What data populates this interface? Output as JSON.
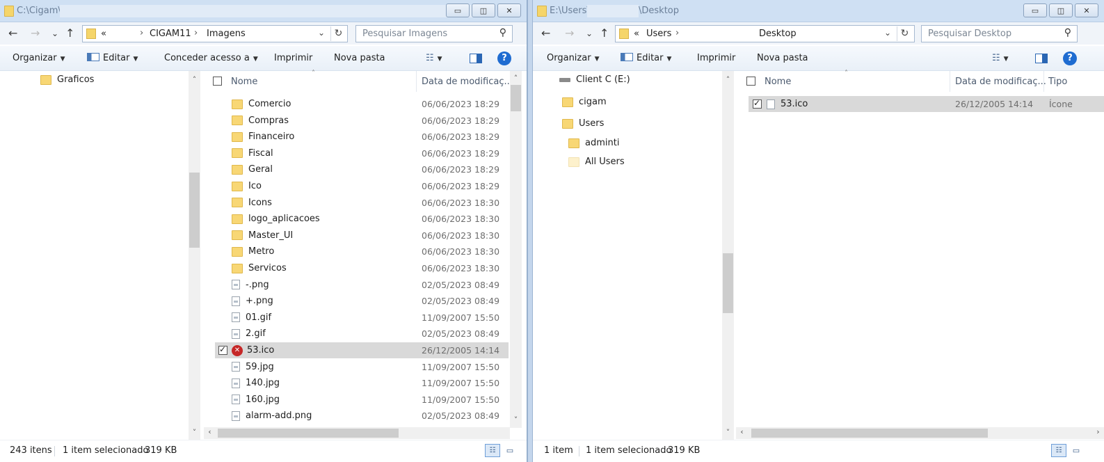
{
  "left": {
    "title": "C:\\Cigam\\",
    "breadcrumb": {
      "root": "«",
      "parts": [
        "CIGAM11",
        "Imagens"
      ]
    },
    "search_placeholder": "Pesquisar Imagens",
    "toolbar": {
      "organize": "Organizar",
      "edit": "Editar",
      "share": "Conceder acesso a",
      "print": "Imprimir",
      "new_folder": "Nova pasta"
    },
    "nav": [
      {
        "label": "Graficos",
        "icon": "folder-icon"
      }
    ],
    "columns": {
      "name": "Nome",
      "date": "Data de modificaç..."
    },
    "files": [
      {
        "name": "Comercio",
        "date": "06/06/2023 18:29",
        "icon": "folder-icon"
      },
      {
        "name": "Compras",
        "date": "06/06/2023 18:29",
        "icon": "folder-icon"
      },
      {
        "name": "Financeiro",
        "date": "06/06/2023 18:29",
        "icon": "folder-icon"
      },
      {
        "name": "Fiscal",
        "date": "06/06/2023 18:29",
        "icon": "folder-icon"
      },
      {
        "name": "Geral",
        "date": "06/06/2023 18:29",
        "icon": "folder-icon"
      },
      {
        "name": "Ico",
        "date": "06/06/2023 18:29",
        "icon": "folder-icon"
      },
      {
        "name": "Icons",
        "date": "06/06/2023 18:30",
        "icon": "folder-icon"
      },
      {
        "name": "logo_aplicacoes",
        "date": "06/06/2023 18:30",
        "icon": "folder-icon"
      },
      {
        "name": "Master_UI",
        "date": "06/06/2023 18:30",
        "icon": "folder-icon"
      },
      {
        "name": "Metro",
        "date": "06/06/2023 18:30",
        "icon": "folder-icon"
      },
      {
        "name": "Servicos",
        "date": "06/06/2023 18:30",
        "icon": "folder-icon"
      },
      {
        "name": "-.png",
        "date": "02/05/2023 08:49",
        "icon": "image-file-icon"
      },
      {
        "name": "+.png",
        "date": "02/05/2023 08:49",
        "icon": "image-file-icon"
      },
      {
        "name": "01.gif",
        "date": "11/09/2007 15:50",
        "icon": "image-file-icon"
      },
      {
        "name": "2.gif",
        "date": "02/05/2023 08:49",
        "icon": "image-file-icon"
      },
      {
        "name": "53.ico",
        "date": "26/12/2005 14:14",
        "icon": "error-icon",
        "selected": true
      },
      {
        "name": "59.jpg",
        "date": "11/09/2007 15:50",
        "icon": "image-file-icon"
      },
      {
        "name": "140.jpg",
        "date": "11/09/2007 15:50",
        "icon": "image-file-icon"
      },
      {
        "name": "160.jpg",
        "date": "11/09/2007 15:50",
        "icon": "image-file-icon"
      },
      {
        "name": "alarm-add.png",
        "date": "02/05/2023 08:49",
        "icon": "image-file-icon"
      }
    ],
    "status": {
      "count": "243 itens",
      "selected": "1 item selecionado",
      "size": "319 KB"
    }
  },
  "right": {
    "title_prefix": "E:\\Users\\",
    "title_suffix": "\\Desktop",
    "breadcrumb": {
      "root": "«",
      "parts": [
        "Users",
        "Desktop"
      ]
    },
    "search_placeholder": "Pesquisar Desktop",
    "toolbar": {
      "organize": "Organizar",
      "edit": "Editar",
      "print": "Imprimir",
      "new_folder": "Nova pasta"
    },
    "nav": [
      {
        "label": "Client C (E:)",
        "icon": "drive-icon"
      },
      {
        "label": "cigam",
        "icon": "folder-icon"
      },
      {
        "label": "Users",
        "icon": "folder-icon"
      },
      {
        "label": "adminti",
        "icon": "folder-icon"
      },
      {
        "label": "All Users",
        "icon": "folder-faint-icon"
      }
    ],
    "columns": {
      "name": "Nome",
      "date": "Data de modificaç...",
      "type": "Tipo"
    },
    "files": [
      {
        "name": "53.ico",
        "date": "26/12/2005 14:14",
        "type": "Ícone",
        "icon": "file-icon",
        "selected": true
      }
    ],
    "status": {
      "count": "1 item",
      "selected": "1 item selecionado",
      "size": "319 KB"
    }
  },
  "icons": {
    "back": "←",
    "forward": "→",
    "recent": "⌄",
    "up": "↑",
    "refresh": "↻",
    "search": "⚲",
    "minimize": "▭",
    "maximize": "◫",
    "close": "✕",
    "help": "?",
    "view": "☷"
  }
}
